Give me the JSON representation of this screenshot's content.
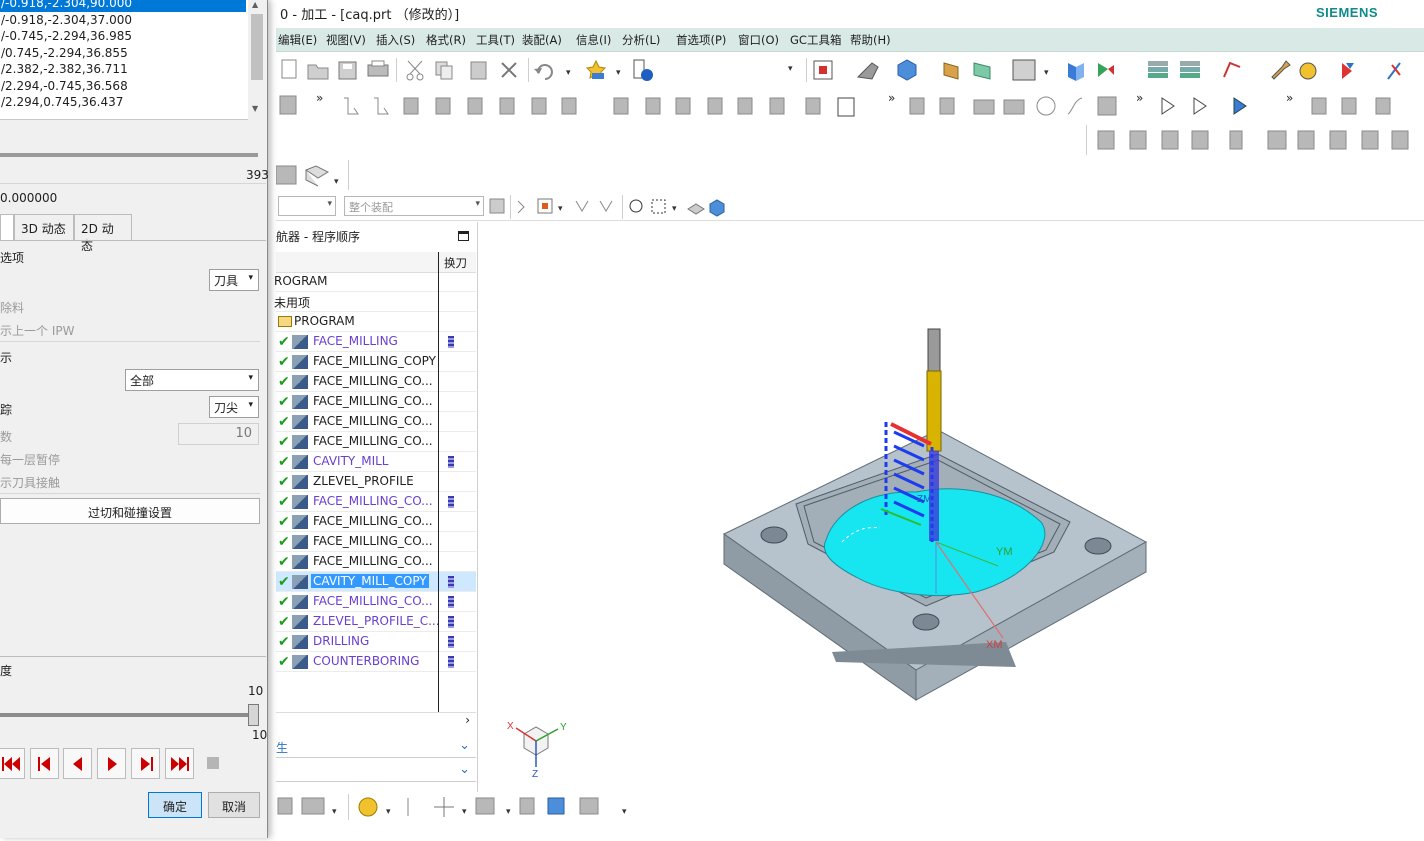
{
  "window": {
    "title": "0 - 加工 - [caq.prt （修改的）]",
    "brand": "SIEMENS"
  },
  "menu": [
    "编辑(E)",
    "视图(V)",
    "插入(S)",
    "格式(R)",
    "工具(T)",
    "装配(A)",
    "信息(I)",
    "分析(L)",
    "首选项(P)",
    "窗口(O)",
    "GC工具箱",
    "帮助(H)"
  ],
  "filter": {
    "selection_filter": "",
    "scope": "整个装配"
  },
  "navigator": {
    "title": "航器 - 程序顺序",
    "column_tool_change": "换刀",
    "rows": [
      {
        "label": "ROGRAM",
        "level": 0,
        "check": false,
        "purple": false,
        "tool": false,
        "selected": false
      },
      {
        "label": "未用项",
        "level": 0,
        "check": false,
        "purple": false,
        "tool": false,
        "selected": false
      },
      {
        "label": "PROGRAM",
        "level": 1,
        "check": false,
        "purple": false,
        "tool": false,
        "selected": false
      },
      {
        "label": "FACE_MILLING",
        "level": 2,
        "check": true,
        "purple": true,
        "tool": true,
        "selected": false
      },
      {
        "label": "FACE_MILLING_COPY",
        "level": 2,
        "check": true,
        "purple": false,
        "tool": false,
        "selected": false
      },
      {
        "label": "FACE_MILLING_CO...",
        "level": 2,
        "check": true,
        "purple": false,
        "tool": false,
        "selected": false
      },
      {
        "label": "FACE_MILLING_CO...",
        "level": 2,
        "check": true,
        "purple": false,
        "tool": false,
        "selected": false
      },
      {
        "label": "FACE_MILLING_CO...",
        "level": 2,
        "check": true,
        "purple": false,
        "tool": false,
        "selected": false
      },
      {
        "label": "FACE_MILLING_CO...",
        "level": 2,
        "check": true,
        "purple": false,
        "tool": false,
        "selected": false
      },
      {
        "label": "CAVITY_MILL",
        "level": 2,
        "check": true,
        "purple": true,
        "tool": true,
        "selected": false
      },
      {
        "label": "ZLEVEL_PROFILE",
        "level": 2,
        "check": true,
        "purple": false,
        "tool": false,
        "selected": false
      },
      {
        "label": "FACE_MILLING_CO...",
        "level": 2,
        "check": true,
        "purple": true,
        "tool": true,
        "selected": false
      },
      {
        "label": "FACE_MILLING_CO...",
        "level": 2,
        "check": true,
        "purple": false,
        "tool": false,
        "selected": false
      },
      {
        "label": "FACE_MILLING_CO...",
        "level": 2,
        "check": true,
        "purple": false,
        "tool": false,
        "selected": false
      },
      {
        "label": "FACE_MILLING_CO...",
        "level": 2,
        "check": true,
        "purple": false,
        "tool": false,
        "selected": false
      },
      {
        "label": "CAVITY_MILL_COPY",
        "level": 2,
        "check": true,
        "purple": false,
        "tool": true,
        "selected": true
      },
      {
        "label": "FACE_MILLING_CO...",
        "level": 2,
        "check": true,
        "purple": true,
        "tool": true,
        "selected": false
      },
      {
        "label": "ZLEVEL_PROFILE_C...",
        "level": 2,
        "check": true,
        "purple": true,
        "tool": true,
        "selected": false
      },
      {
        "label": "DRILLING",
        "level": 2,
        "check": true,
        "purple": true,
        "tool": true,
        "selected": false
      },
      {
        "label": "COUNTERBORING",
        "level": 2,
        "check": true,
        "purple": true,
        "tool": true,
        "selected": false
      }
    ],
    "footer_1": "生",
    "footer_2": ""
  },
  "graphics": {
    "axis_labels": {
      "ym": "YM",
      "xm": "XM",
      "zm": "ZM",
      "x": "X",
      "y": "Y",
      "z": "Z"
    },
    "colors": {
      "floor": "#17e5f0",
      "body": "#a9b6c0",
      "toolholder": "#d8b400",
      "toolpath": "#1d3cf0",
      "cut": "#e83030"
    }
  },
  "dialog": {
    "coordinates": [
      "/-0.918,-2.304,90.000",
      "/-0.918,-2.304,37.000",
      "/-0.745,-2.294,36.985",
      "/0.745,-2.294,36.855",
      "/2.382,-2.382,36.711",
      "/2.294,-0.745,36.568",
      "/2.294,0.745,36.437"
    ],
    "selected_coordinate_index": 0,
    "line_count": "393",
    "feed_value": "0.000000",
    "tabs": [
      "",
      "3D 动态",
      "2D 动态"
    ],
    "active_tab_index": 0,
    "section_options": "选项",
    "display_value": "刀具",
    "remove_material": "除料",
    "show_previous_ipw": "示上一个 IPW",
    "section_display": "示",
    "path_display_value": "全部",
    "trace_label": "踪",
    "trace_value": "刀尖",
    "count_label": "数",
    "count_value": "10",
    "pause_each_layer": "每一层暂停",
    "show_tool_contact": "示刀具接触",
    "gouge_button": "过切和碰撞设置",
    "speed_label": "度",
    "speed_max": "10",
    "speed_value": "10",
    "speed_fraction": 1.0,
    "progress_fraction": 1.0,
    "ok_button": "确定",
    "cancel_button": "取消"
  }
}
